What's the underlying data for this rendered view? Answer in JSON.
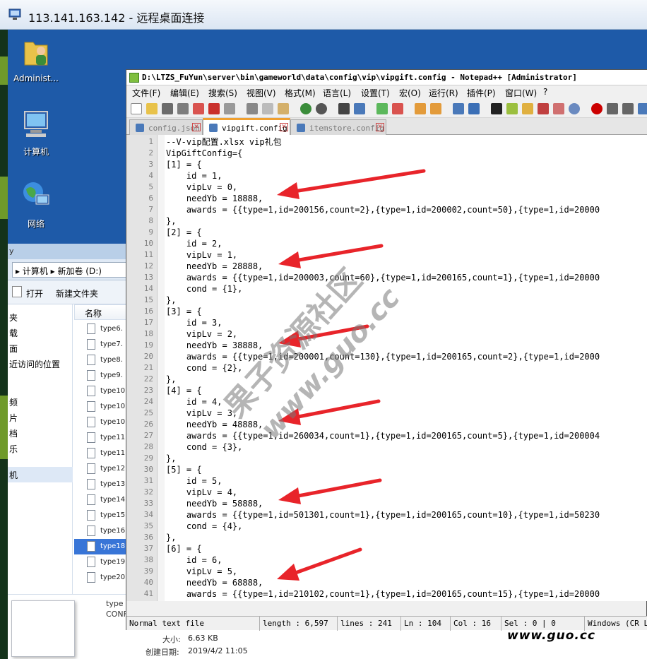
{
  "rdp": {
    "title": "113.141.163.142 - 远程桌面连接"
  },
  "desktop": {
    "icons": [
      {
        "label": "Administ...",
        "icon": "user-folder-icon"
      },
      {
        "label": "计算机",
        "icon": "computer-icon"
      },
      {
        "label": "网络",
        "icon": "network-globe-icon"
      }
    ]
  },
  "explorer": {
    "title_fragment": "y",
    "address": "▸ 计算机 ▸ 新加卷 (D:)",
    "toolbar": {
      "open": "打开",
      "new_folder": "新建文件夹"
    },
    "nav_items": [
      "夹",
      "载",
      "面",
      "近访问的位置",
      "",
      "频",
      "片",
      "档",
      "乐",
      "",
      "机"
    ],
    "column_header": "名称",
    "files": [
      "type6.",
      "type7.",
      "type8.",
      "type9.",
      "type10",
      "type10",
      "type10",
      "type11",
      "type11",
      "type12",
      "type13",
      "type14",
      "type15",
      "type16",
      "type18",
      "type19",
      "type20"
    ],
    "selected_index": 14,
    "details": {
      "name_fragment": "type",
      "type_fragment": "CONFI",
      "size_label": "大小:",
      "size_value": "6.63 KB",
      "date_label": "创建日期:",
      "date_value": "2019/4/2 11:05"
    }
  },
  "npp": {
    "title": "D:\\LTZS_FuYun\\server\\bin\\gameworld\\data\\config\\vip\\vipgift.config - Notepad++ [Administrator]",
    "menu": [
      "文件(F)",
      "编辑(E)",
      "搜索(S)",
      "视图(V)",
      "格式(M)",
      "语言(L)",
      "设置(T)",
      "宏(O)",
      "运行(R)",
      "插件(P)",
      "窗口(W)",
      "?"
    ],
    "tabs": [
      {
        "label": "config.json",
        "active": false
      },
      {
        "label": "vipgift.config",
        "active": true
      },
      {
        "label": "itemstore.config",
        "active": false
      }
    ],
    "lines": [
      {
        "n": "1",
        "text": "--V-vip配置.xlsx vip礼包"
      },
      {
        "n": "2",
        "text": "VipGiftConfig={"
      },
      {
        "n": "3",
        "text": "[1] = {"
      },
      {
        "n": "4",
        "text": "    id = 1,"
      },
      {
        "n": "5",
        "text": "    vipLv = 0,"
      },
      {
        "n": "6",
        "text": "    needYb = 18888,"
      },
      {
        "n": "7",
        "text": "    awards = {{type=1,id=200156,count=2},{type=1,id=200002,count=50},{type=1,id=20000"
      },
      {
        "n": "8",
        "text": "},"
      },
      {
        "n": "9",
        "text": "[2] = {"
      },
      {
        "n": "10",
        "text": "    id = 2,"
      },
      {
        "n": "11",
        "text": "    vipLv = 1,"
      },
      {
        "n": "12",
        "text": "    needYb = 28888,"
      },
      {
        "n": "13",
        "text": "    awards = {{type=1,id=200003,count=60},{type=1,id=200165,count=1},{type=1,id=20000"
      },
      {
        "n": "14",
        "text": "    cond = {1},"
      },
      {
        "n": "15",
        "text": "},"
      },
      {
        "n": "16",
        "text": "[3] = {"
      },
      {
        "n": "17",
        "text": "    id = 3,"
      },
      {
        "n": "18",
        "text": "    vipLv = 2,"
      },
      {
        "n": "19",
        "text": "    needYb = 38888,"
      },
      {
        "n": "20",
        "text": "    awards = {{type=1,id=200001,count=130},{type=1,id=200165,count=2},{type=1,id=2000"
      },
      {
        "n": "21",
        "text": "    cond = {2},"
      },
      {
        "n": "22",
        "text": "},"
      },
      {
        "n": "23",
        "text": "[4] = {"
      },
      {
        "n": "24",
        "text": "    id = 4,"
      },
      {
        "n": "25",
        "text": "    vipLv = 3,"
      },
      {
        "n": "26",
        "text": "    needYb = 48888,"
      },
      {
        "n": "27",
        "text": "    awards = {{type=1,id=260034,count=1},{type=1,id=200165,count=5},{type=1,id=200004"
      },
      {
        "n": "28",
        "text": "    cond = {3},"
      },
      {
        "n": "29",
        "text": "},"
      },
      {
        "n": "30",
        "text": "[5] = {"
      },
      {
        "n": "31",
        "text": "    id = 5,"
      },
      {
        "n": "32",
        "text": "    vipLv = 4,"
      },
      {
        "n": "33",
        "text": "    needYb = 58888,"
      },
      {
        "n": "34",
        "text": "    awards = {{type=1,id=501301,count=1},{type=1,id=200165,count=10},{type=1,id=50230"
      },
      {
        "n": "35",
        "text": "    cond = {4},"
      },
      {
        "n": "36",
        "text": "},"
      },
      {
        "n": "37",
        "text": "[6] = {"
      },
      {
        "n": "38",
        "text": "    id = 6,"
      },
      {
        "n": "39",
        "text": "    vipLv = 5,"
      },
      {
        "n": "40",
        "text": "    needYb = 68888,"
      },
      {
        "n": "41",
        "text": "    awards = {{type=1,id=210102,count=1},{type=1,id=200165,count=15},{type=1,id=20000"
      }
    ],
    "status": {
      "filetype": "Normal text file",
      "length": "length : 6,597",
      "lines": "lines : 241",
      "ln": "Ln : 104",
      "col": "Col : 16",
      "sel": "Sel : 0 | 0",
      "eol": "Windows (CR LF)"
    }
  },
  "watermark": {
    "cn": "果子资源社区",
    "url_diag": "www.guo.cc",
    "url_corner": "www.guo.cc"
  },
  "colors": {
    "arrow": "#e8242a",
    "desktop": "#1e5aa8"
  }
}
